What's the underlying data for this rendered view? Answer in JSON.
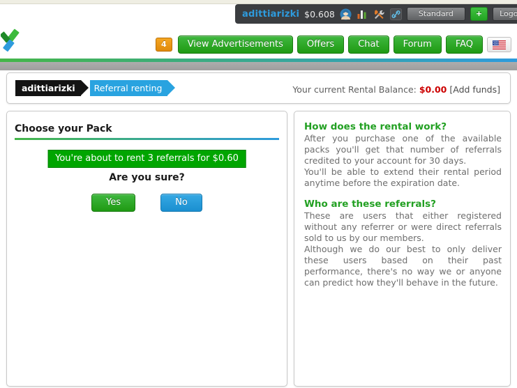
{
  "userbar": {
    "username": "adittiarizki",
    "balance": "$0.608",
    "membership_label": "Standard",
    "upgrade_label": "+",
    "logout_label": "Logout",
    "icons": [
      "avatar-icon",
      "bar-chart-icon",
      "tools-icon",
      "link-icon",
      "padlock-icon"
    ]
  },
  "nav": {
    "badge_count": "4",
    "items": [
      {
        "label": "View Advertisements"
      },
      {
        "label": "Offers"
      },
      {
        "label": "Chat"
      },
      {
        "label": "Forum"
      },
      {
        "label": "FAQ"
      }
    ],
    "language_flag": "us-flag-icon"
  },
  "breadcrumb": {
    "account": "adittiarizki",
    "section": "Referral renting"
  },
  "balance_bar": {
    "label": "Your current Rental Balance:",
    "amount": "$0.00",
    "add_funds": "[Add funds]"
  },
  "pack": {
    "title": "Choose your Pack",
    "confirm_message": "You're about to rent 3 referrals for $0.60",
    "question": "Are you sure?",
    "yes_label": "Yes",
    "no_label": "No"
  },
  "faq": [
    {
      "heading": "How does the rental work?",
      "paragraphs": [
        "After you purchase one of the available packs you'll get that number of referrals credited to your account for 30 days.",
        "You'll be able to extend their rental period anytime before the expiration date."
      ]
    },
    {
      "heading": "Who are these referrals?",
      "paragraphs": [
        "These are users that either registered without any referrer or were direct referrals sold to us by our members.",
        "Although we do our best to only deliver these users based on their past performance, there's no way we or anyone can predict how they'll behave in the future."
      ]
    }
  ],
  "colors": {
    "brand_green": "#45b649",
    "brand_blue": "#2e9bdd",
    "badge_orange": "#f5a623",
    "balance_red": "#cc0000",
    "userbar_dark": "#3b3d40"
  }
}
